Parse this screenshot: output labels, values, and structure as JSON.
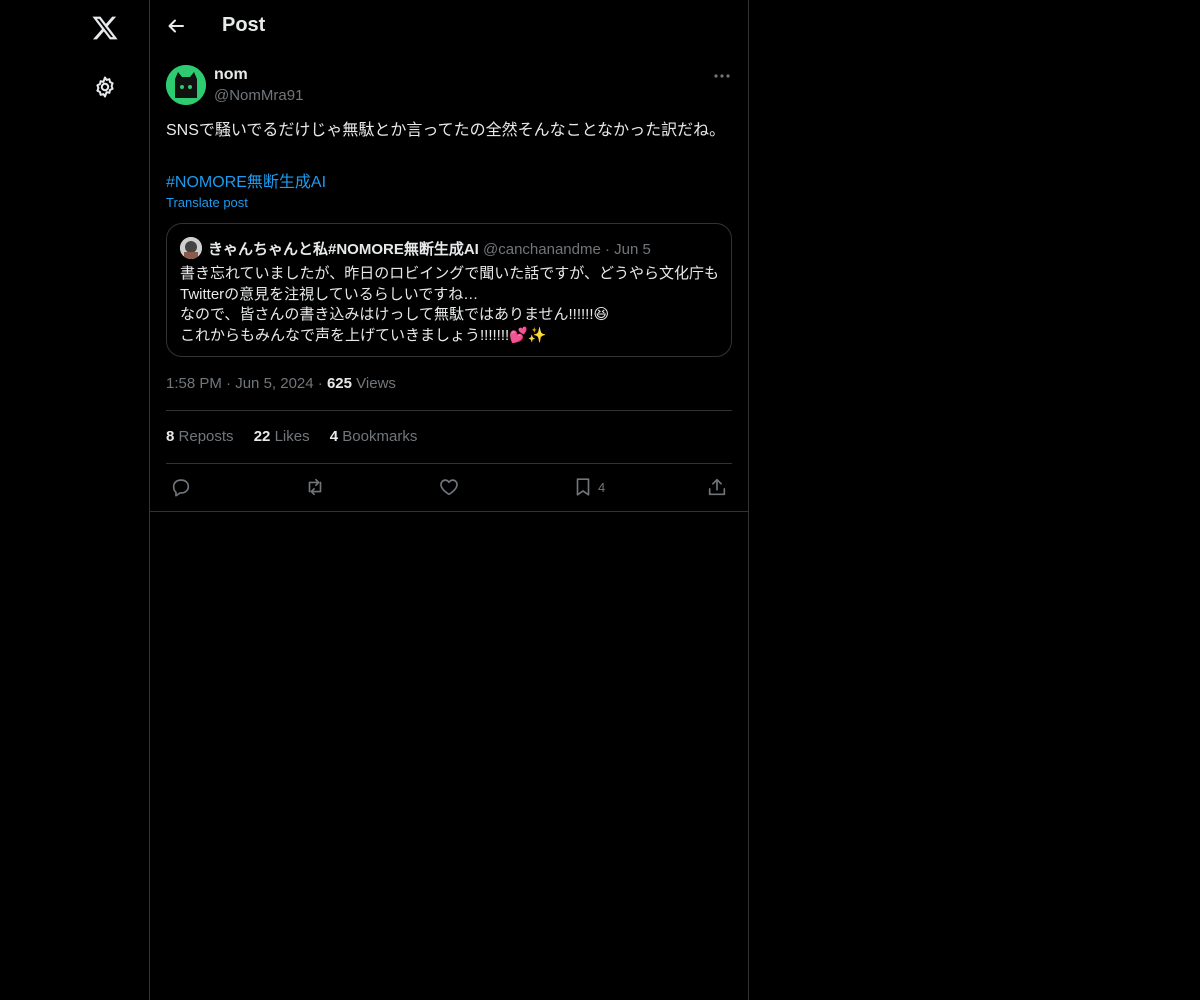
{
  "header": {
    "title": "Post"
  },
  "icons": {
    "logo": "x-logo-icon",
    "settings": "gear-icon",
    "back": "back-arrow-icon",
    "more": "more-dots-icon",
    "reply": "reply-icon",
    "repost": "repost-icon",
    "like": "heart-icon",
    "bookmark": "bookmark-icon",
    "share": "share-icon"
  },
  "post": {
    "author_name": "nom",
    "author_handle": "@NomMra91",
    "text": "SNSで騒いでるだけじゃ無駄とか言ってたの全然そんなことなかった訳だね。",
    "hashtag": "#NOMORE無断生成AI",
    "translate_label": "Translate post",
    "time": "1:58 PM",
    "date": "Jun 5, 2024",
    "views_count": "625",
    "views_label": "Views"
  },
  "quote": {
    "author_name": "きゃんちゃんと私#NOMORE無断生成AI",
    "author_handle": "@canchanandme",
    "date": "Jun 5",
    "lines": [
      "書き忘れていましたが、昨日のロビイングで聞いた話ですが、どうやら文化庁も",
      "Twitterの意見を注視しているらしいですね…",
      "なので、皆さんの書き込みはけっして無駄ではありません!!!!!!😆",
      "これからもみんなで声を上げていきましょう!!!!!!!💕✨"
    ]
  },
  "stats": {
    "reposts_count": "8",
    "reposts_label": "Reposts",
    "likes_count": "22",
    "likes_label": "Likes",
    "bookmarks_count": "4",
    "bookmarks_label": "Bookmarks"
  },
  "actions": {
    "bookmark_count": "4"
  },
  "colors": {
    "accent": "#1d9bf0",
    "background": "#000000",
    "border": "#2f3336",
    "muted": "#71767b"
  }
}
